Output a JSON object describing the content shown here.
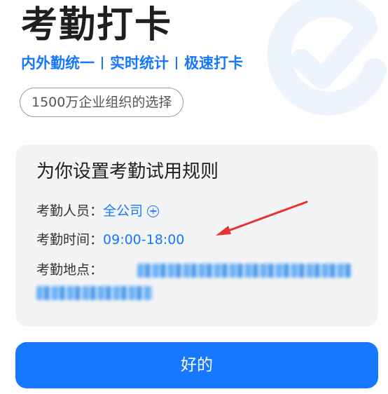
{
  "header": {
    "title": "考勤打卡",
    "features": [
      "内外勤统一",
      "实时统计",
      "极速打卡"
    ],
    "badge": "1500万企业组织的选择"
  },
  "card": {
    "title": "为你设置考勤试用规则",
    "rows": [
      {
        "label": "考勤人员：",
        "value": "全公司",
        "icon": "plus-circle-icon"
      },
      {
        "label": "考勤时间：",
        "value": "09:00-18:00"
      },
      {
        "label": "考勤地点：",
        "value": ""
      }
    ]
  },
  "annotation": {
    "color": "#e8332f",
    "icon": "red-arrow"
  },
  "actions": {
    "confirm_label": "好的"
  },
  "colors": {
    "accent": "#1677ff",
    "card_bg": "#f3f4f6"
  }
}
